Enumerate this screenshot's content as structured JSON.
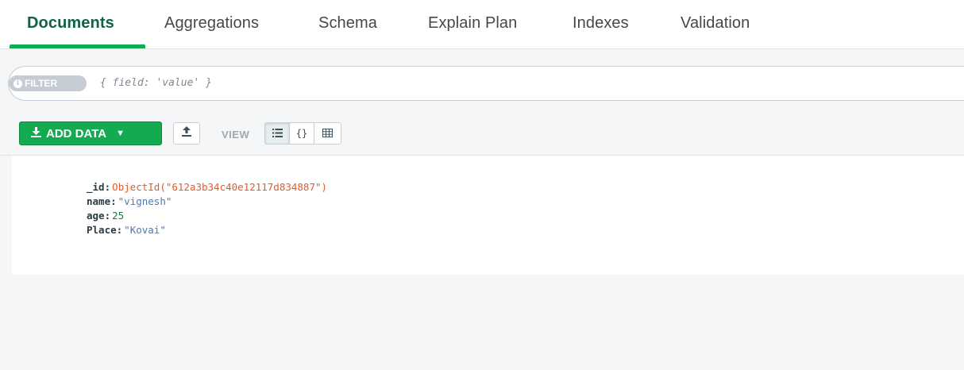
{
  "tabs": [
    {
      "label": "Documents",
      "active": true
    },
    {
      "label": "Aggregations",
      "active": false
    },
    {
      "label": "Schema",
      "active": false
    },
    {
      "label": "Explain Plan",
      "active": false
    },
    {
      "label": "Indexes",
      "active": false
    },
    {
      "label": "Validation",
      "active": false
    }
  ],
  "filter": {
    "pill_label": "FILTER",
    "pill_icon": "info-icon",
    "placeholder": "{ field: 'value' }"
  },
  "toolbar": {
    "add_data_label": "ADD DATA",
    "add_data_icon": "download-icon",
    "import_icon": "upload-icon",
    "view_label": "VIEW",
    "view_modes": [
      {
        "icon": "list-view-icon",
        "active": true
      },
      {
        "icon": "json-view-icon",
        "active": false
      },
      {
        "icon": "table-view-icon",
        "active": false
      }
    ]
  },
  "document": {
    "fields": [
      {
        "key": "_id",
        "value": "ObjectId(\"612a3b34c40e12117d834887\")",
        "type": "objectid"
      },
      {
        "key": "name",
        "value": "\"vignesh\"",
        "type": "string"
      },
      {
        "key": "age",
        "value": "25",
        "type": "number"
      },
      {
        "key": "Place",
        "value": "\"Kovai\"",
        "type": "string"
      }
    ]
  },
  "colors": {
    "accent": "#13aa52",
    "active_tab": "#116149",
    "objectid": "#e85a25",
    "string": "#4a7ab8",
    "number": "#1b7a3e"
  }
}
